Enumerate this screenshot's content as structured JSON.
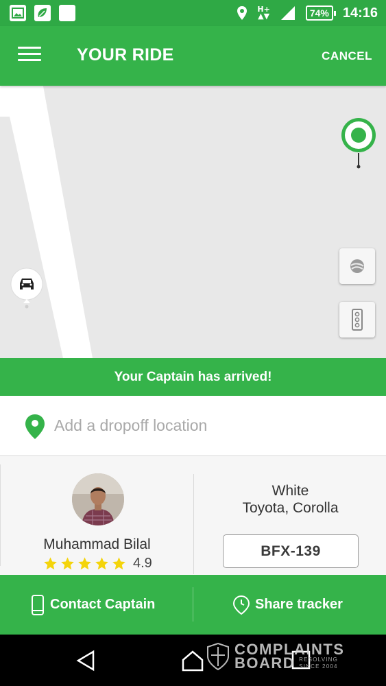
{
  "status_bar": {
    "network": "H+",
    "battery": "74%",
    "time": "14:16"
  },
  "app_bar": {
    "title": "YOUR RIDE",
    "cancel_label": "CANCEL"
  },
  "map": {
    "marker_pickup": "pickup-location-pin",
    "marker_car": "car-icon",
    "buttons": [
      "google-earth-icon",
      "traffic-light-icon"
    ]
  },
  "banner": {
    "text": "Your Captain has arrived!"
  },
  "dropoff": {
    "placeholder": "Add a dropoff location"
  },
  "captain": {
    "name": "Muhammad Bilal",
    "rating": "4.9",
    "stars": 5
  },
  "vehicle": {
    "color": "White",
    "model": "Toyota, Corolla",
    "plate": "BFX-139"
  },
  "actions": {
    "contact": "Contact Captain",
    "share": "Share tracker"
  },
  "watermark": {
    "line1": "COMPLAINTS",
    "line2": "BOARD",
    "tag1": "RESOLVING",
    "tag2": "SINCE 2004"
  },
  "colors": {
    "brand_green": "#35b34a",
    "status_green": "#2fa945",
    "star_yellow": "#f4d40b"
  }
}
